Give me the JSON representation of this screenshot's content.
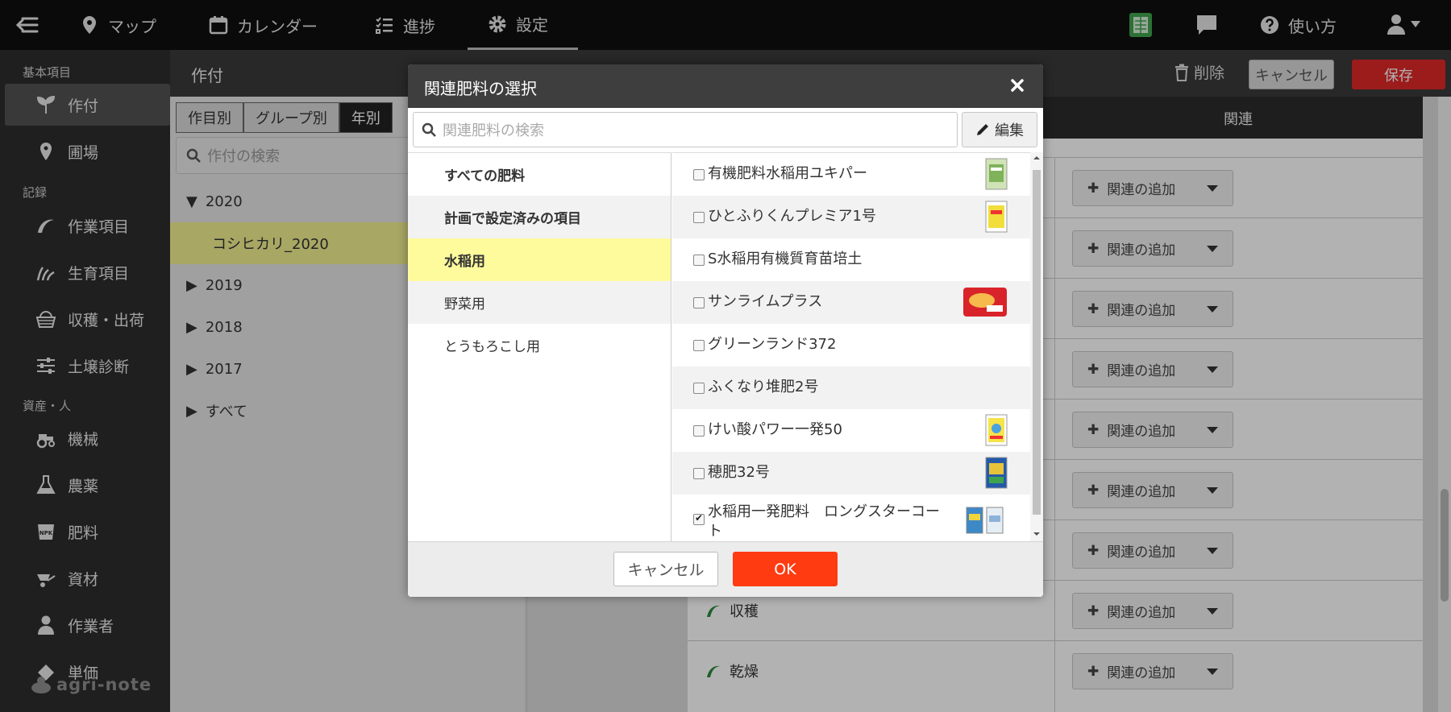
{
  "topnav": {
    "items": [
      {
        "label": "マップ",
        "icon": "map-pin-icon"
      },
      {
        "label": "カレンダー",
        "icon": "calendar-icon"
      },
      {
        "label": "進捗",
        "icon": "checklist-icon"
      },
      {
        "label": "設定",
        "icon": "gear-icon",
        "active": true
      }
    ],
    "help_label": "使い方"
  },
  "subheader": {
    "title": "作付",
    "delete_label": "削除",
    "cancel_label": "キャンセル",
    "save_label": "保存"
  },
  "sidebar": {
    "sections": [
      "基本項目",
      "記録",
      "資産・人"
    ],
    "items": [
      {
        "label": "作付",
        "icon": "sprout-icon",
        "active": true
      },
      {
        "label": "圃場",
        "icon": "map-pin-icon"
      },
      {
        "label": "作業項目",
        "icon": "sickle-icon"
      },
      {
        "label": "生育項目",
        "icon": "growth-icon"
      },
      {
        "label": "収穫・出荷",
        "icon": "basket-icon"
      },
      {
        "label": "土壌診断",
        "icon": "sliders-icon"
      },
      {
        "label": "機械",
        "icon": "tractor-icon"
      },
      {
        "label": "農薬",
        "icon": "flask-icon"
      },
      {
        "label": "肥料",
        "icon": "npk-icon"
      },
      {
        "label": "資材",
        "icon": "wheelbarrow-icon"
      },
      {
        "label": "作業者",
        "icon": "person-icon"
      },
      {
        "label": "単価",
        "icon": "price-icon"
      }
    ],
    "logo_text": "agri-note"
  },
  "leftpanel": {
    "tabs": [
      "作目別",
      "グループ別",
      "年別"
    ],
    "active_tab": 2,
    "search_placeholder": "作付の検索",
    "tree": [
      {
        "label": "2020",
        "expanded": true
      },
      {
        "label": "コシヒカリ_2020",
        "child": true,
        "selected": true
      },
      {
        "label": "2019"
      },
      {
        "label": "2018"
      },
      {
        "label": "2017"
      },
      {
        "label": "すべて"
      }
    ]
  },
  "table": {
    "header_related": "関連",
    "add_label": "関連の追加",
    "rows": [
      {
        "label": ""
      },
      {
        "label": ""
      },
      {
        "label": ""
      },
      {
        "label": ""
      },
      {
        "label": ""
      },
      {
        "label": ""
      },
      {
        "label": ""
      },
      {
        "label": "収穫"
      },
      {
        "label": "乾燥"
      }
    ]
  },
  "modal": {
    "title": "関連肥料の選択",
    "search_placeholder": "関連肥料の検索",
    "edit_label": "編集",
    "categories": [
      {
        "label": "すべての肥料",
        "bold": true
      },
      {
        "label": "計画で設定済みの項目",
        "bold": true
      },
      {
        "label": "水稲用",
        "selected": true
      },
      {
        "label": "野菜用"
      },
      {
        "label": "とうもろこし用"
      }
    ],
    "fertilizers": [
      {
        "label": "有機肥料水稲用ユキパー",
        "checked": false,
        "thumb": "green-bag"
      },
      {
        "label": "ひとふりくんプレミア1号",
        "checked": false,
        "thumb": "yellow-bag"
      },
      {
        "label": "S水稲用有機質育苗培土",
        "checked": false
      },
      {
        "label": "サンライムプラス",
        "checked": false,
        "thumb": "red-bag"
      },
      {
        "label": "グリーンランド372",
        "checked": false
      },
      {
        "label": "ふくなり堆肥2号",
        "checked": false
      },
      {
        "label": "けい酸パワー一発50",
        "checked": false,
        "thumb": "yellow-bag"
      },
      {
        "label": "穂肥32号",
        "checked": false,
        "thumb": "blue-bag"
      },
      {
        "label": "水稲用一発肥料　ロングスターコート",
        "checked": true,
        "thumb": "two-bags"
      }
    ],
    "cancel_label": "キャンセル",
    "ok_label": "OK"
  },
  "colors": {
    "accent_ok": "#ff3b12",
    "save_red": "#e02929",
    "selected_yellow": "#fdfb9c"
  }
}
